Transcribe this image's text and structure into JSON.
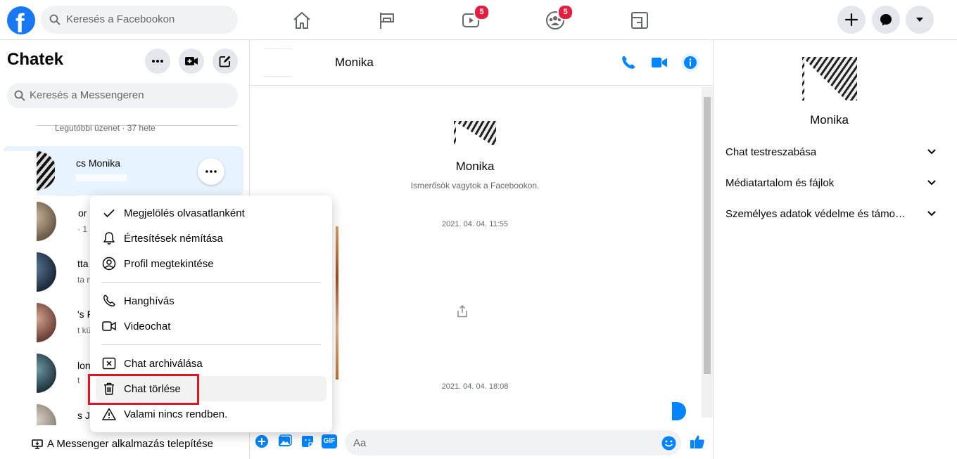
{
  "topbar": {
    "logo": "f",
    "search_placeholder": "Keresés a Facebookon",
    "nav": [
      {
        "name": "home-icon",
        "badge": ""
      },
      {
        "name": "flag-icon",
        "badge": ""
      },
      {
        "name": "watch-icon",
        "badge": "5"
      },
      {
        "name": "groups-icon",
        "badge": "5"
      },
      {
        "name": "gaming-icon",
        "badge": ""
      }
    ],
    "colors": {
      "brand": "#1877f2",
      "badge": "#e41e3f"
    }
  },
  "sidebar": {
    "title": "Chatek",
    "search_placeholder": "Keresés a Messengeren",
    "prev_item_sub": "Legutóbbi üzenet · 37 hete",
    "active_conv": {
      "name": "Kovács Monika",
      "name_visible": "cs Monika"
    },
    "conversations": [
      {
        "name": "or",
        "sub": "· 1"
      },
      {
        "name": "tta",
        "sub": "ta n"
      },
      {
        "name": "'s F",
        "sub": "t kü"
      },
      {
        "name": "lon",
        "sub": "t"
      },
      {
        "name": "s Ju",
        "sub": ""
      }
    ],
    "install_label": "A Messenger alkalmazás telepítése"
  },
  "menu": {
    "items": [
      {
        "label": "Megjelölés olvasatlanként",
        "icon": "check-icon"
      },
      {
        "label": "Értesítések némítása",
        "icon": "bell-icon"
      },
      {
        "label": "Profil megtekintése",
        "icon": "profile-icon"
      },
      {
        "label": "Hanghívás",
        "icon": "phone-icon"
      },
      {
        "label": "Videochat",
        "icon": "video-icon"
      },
      {
        "label": "Chat archiválása",
        "icon": "archive-icon"
      },
      {
        "label": "Chat törlése",
        "icon": "trash-icon"
      },
      {
        "label": "Valami nincs rendben.",
        "icon": "warning-icon"
      }
    ],
    "highlight_color": "#e0161f"
  },
  "chat": {
    "name": "Monika",
    "profile_name": "Monika",
    "profile_sub": "Ismerősök vagytok a Facebookon.",
    "timestamps": [
      "2021. 04. 04. 11:55",
      "2021. 04. 04. 18:08"
    ],
    "composer_placeholder": "Aa",
    "gif_label": "GIF",
    "accent": "#0084ff"
  },
  "right_panel": {
    "name": "Monika",
    "sections": [
      "Chat testreszabása",
      "Médiatartalom és fájlok",
      "Személyes adatok védelme és támogatás"
    ]
  }
}
